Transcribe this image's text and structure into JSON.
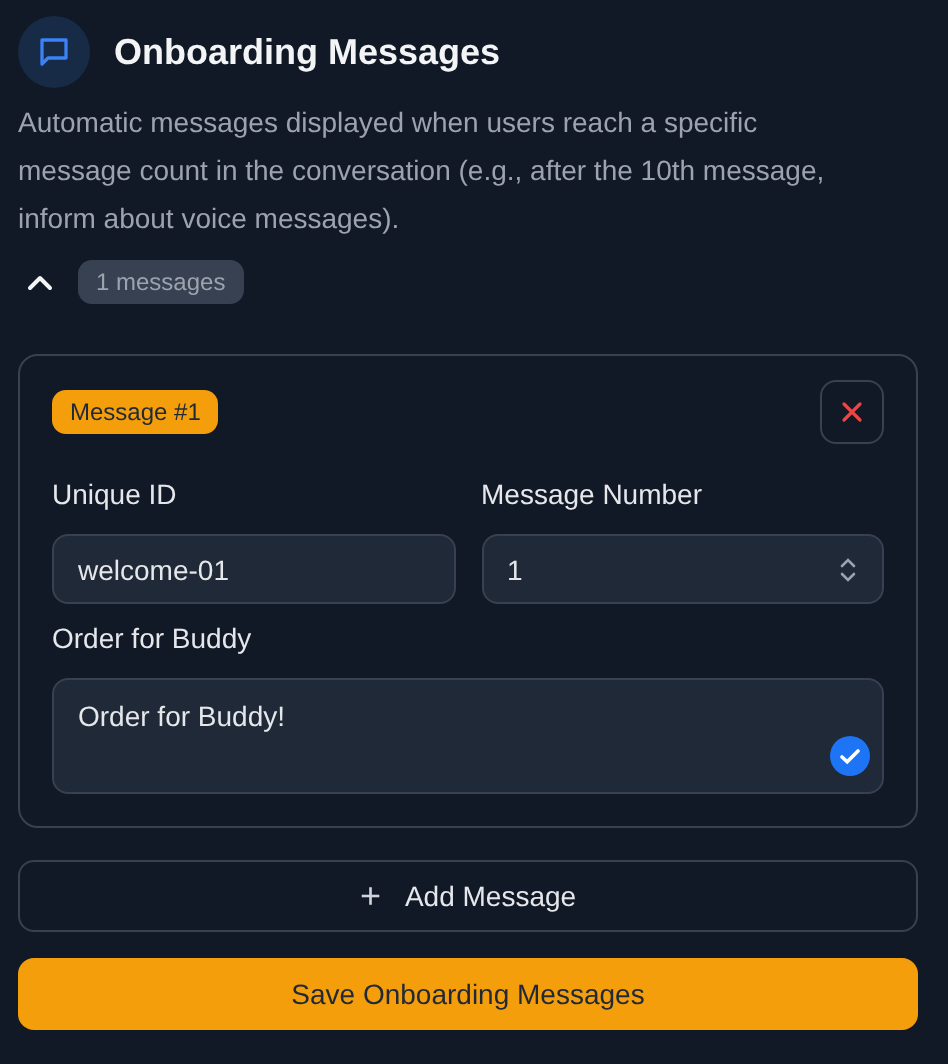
{
  "header": {
    "title": "Onboarding Messages",
    "description": "Automatic messages displayed when users reach a specific message count in the conversation (e.g., after the 10th message, inform about voice messages).",
    "expanded": true,
    "count_badge": "1 messages"
  },
  "messages": [
    {
      "badge": "Message #1",
      "fields": [
        {
          "kind": "text",
          "label": "Unique ID",
          "value": "welcome-01"
        },
        {
          "kind": "number",
          "label": "Message Number",
          "value": "1"
        },
        {
          "kind": "textarea",
          "label": "Order for Buddy",
          "value": "Order for Buddy!"
        }
      ]
    }
  ],
  "add_button": {
    "icon": "+",
    "label": "Add Message"
  },
  "save_button": {
    "label": "Save Onboarding Messages"
  }
}
